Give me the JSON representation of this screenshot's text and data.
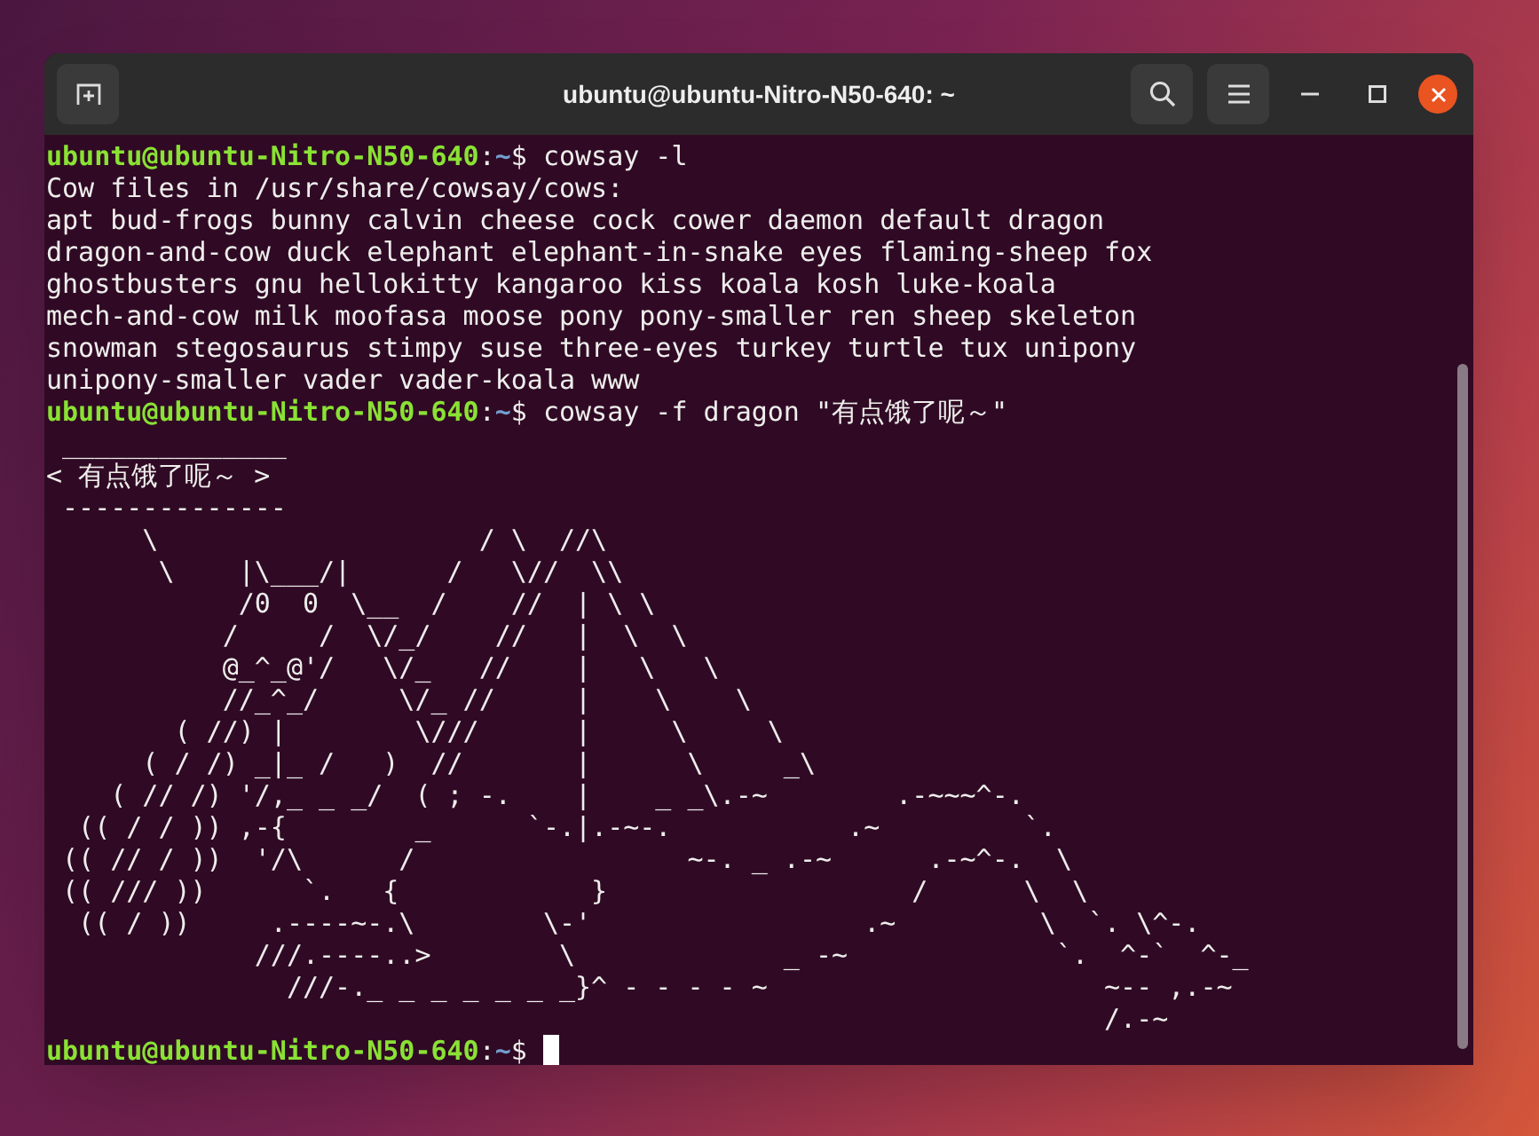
{
  "window": {
    "title": "ubuntu@ubuntu-Nitro-N50-640: ~"
  },
  "terminal": {
    "lines": [
      {
        "kind": "prompt",
        "user_host": "ubuntu@ubuntu-Nitro-N50-640",
        "separator": ":",
        "path": "~",
        "symbol": "$",
        "command": "cowsay -l",
        "cursor": false
      },
      {
        "kind": "output",
        "text": "Cow files in /usr/share/cowsay/cows:"
      },
      {
        "kind": "output",
        "text": "apt bud-frogs bunny calvin cheese cock cower daemon default dragon"
      },
      {
        "kind": "output",
        "text": "dragon-and-cow duck elephant elephant-in-snake eyes flaming-sheep fox"
      },
      {
        "kind": "output",
        "text": "ghostbusters gnu hellokitty kangaroo kiss koala kosh luke-koala"
      },
      {
        "kind": "output",
        "text": "mech-and-cow milk moofasa moose pony pony-smaller ren sheep skeleton"
      },
      {
        "kind": "output",
        "text": "snowman stegosaurus stimpy suse three-eyes turkey turtle tux unipony"
      },
      {
        "kind": "output",
        "text": "unipony-smaller vader vader-koala www"
      },
      {
        "kind": "prompt",
        "user_host": "ubuntu@ubuntu-Nitro-N50-640",
        "separator": ":",
        "path": "~",
        "symbol": "$",
        "command": "cowsay -f dragon \"有点饿了呢～\"",
        "cursor": false
      },
      {
        "kind": "art",
        "text": " ______________"
      },
      {
        "kind": "art",
        "text": "< 有点饿了呢～ >"
      },
      {
        "kind": "art",
        "text": " --------------"
      },
      {
        "kind": "art",
        "text": "      \\                    / \\  //\\"
      },
      {
        "kind": "art",
        "text": "       \\    |\\___/|      /   \\//  \\\\"
      },
      {
        "kind": "art",
        "text": "            /0  0  \\__  /    //  | \\ \\"
      },
      {
        "kind": "art",
        "text": "           /     /  \\/_/    //   |  \\  \\"
      },
      {
        "kind": "art",
        "text": "           @_^_@'/   \\/_   //    |   \\   \\"
      },
      {
        "kind": "art",
        "text": "           //_^_/     \\/_ //     |    \\    \\"
      },
      {
        "kind": "art",
        "text": "        ( //) |        \\///      |     \\     \\"
      },
      {
        "kind": "art",
        "text": "      ( / /) _|_ /   )  //       |      \\     _\\"
      },
      {
        "kind": "art",
        "text": "    ( // /) '/,_ _ _/  ( ; -.    |    _ _\\.-~        .-~~~^-."
      },
      {
        "kind": "art",
        "text": "  (( / / )) ,-{        _      `-.|.-~-.           .~         `."
      },
      {
        "kind": "art",
        "text": " (( // / ))  '/\\      /                 ~-. _ .-~      .-~^-.  \\"
      },
      {
        "kind": "art",
        "text": " (( /// ))      `.   {            }                   /      \\  \\"
      },
      {
        "kind": "art",
        "text": "  (( / ))     .----~-.\\        \\-'                 .~         \\  `. \\^-."
      },
      {
        "kind": "art",
        "text": "             ///.----..>        \\             _ -~             `.  ^-`  ^-_"
      },
      {
        "kind": "art",
        "text": "               ///-._ _ _ _ _ _ _}^ - - - - ~                     ~-- ,.-~"
      },
      {
        "kind": "art",
        "text": "                                                                  /.-~"
      },
      {
        "kind": "prompt",
        "user_host": "ubuntu@ubuntu-Nitro-N50-640",
        "separator": ":",
        "path": "~",
        "symbol": "$",
        "cursor": true
      }
    ]
  }
}
